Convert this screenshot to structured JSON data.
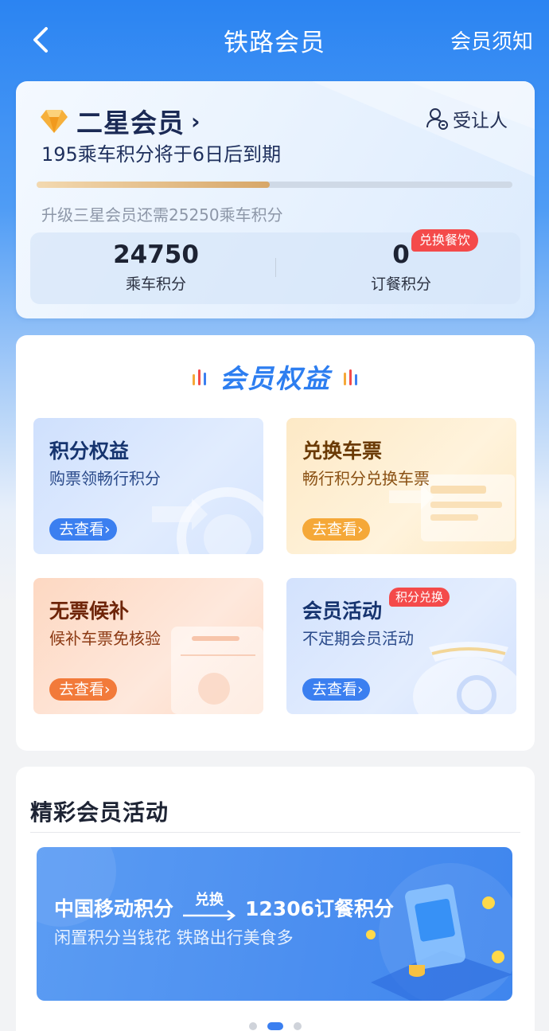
{
  "header": {
    "title": "铁路会员",
    "notice_label": "会员须知"
  },
  "member": {
    "level": "二星会员",
    "transfer_label": "受让人",
    "expire_text": "195乘车积分将于6日后到期",
    "progress_percent": 49,
    "upgrade_text": "升级三星会员还需25250乘车积分",
    "ride_points": "24750",
    "ride_points_label": "乘车积分",
    "meal_points": "0",
    "meal_points_label": "订餐积分",
    "redeem_badge": "兑换餐饮"
  },
  "benefits": {
    "title": "会员权益",
    "tiles": [
      {
        "title": "积分权益",
        "subtitle": "购票领畅行积分",
        "button": "去查看"
      },
      {
        "title": "兑换车票",
        "subtitle": "畅行积分兑换车票",
        "button": "去查看"
      },
      {
        "title": "无票候补",
        "subtitle": "候补车票免核验",
        "button": "去查看"
      },
      {
        "title": "会员活动",
        "subtitle": "不定期会员活动",
        "button": "去查看",
        "badge": "积分兑换"
      }
    ]
  },
  "activities": {
    "title": "精彩会员活动",
    "banner": {
      "left": "中国移动积分",
      "arrow": "兑换",
      "right": "12306订餐积分",
      "subtitle": "闲置积分当钱花 铁路出行美食多"
    },
    "carousel_active_index": 1
  },
  "colors": {
    "header_blue": "#2b84f2",
    "accent_blue": "#3b7ff0",
    "badge_red": "#f44a4a",
    "progress_gold": "#d7a768"
  }
}
